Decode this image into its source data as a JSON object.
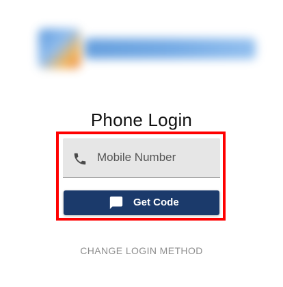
{
  "login": {
    "title": "Phone Login",
    "phone_field": {
      "placeholder": "Mobile Number",
      "icon": "phone-icon"
    },
    "submit_button": {
      "label": "Get Code",
      "icon": "message-icon",
      "color": "#1b3a6b"
    },
    "change_method_link": "CHANGE LOGIN METHOD"
  },
  "colors": {
    "highlight_border": "#ff0000",
    "field_background": "#e6e6e6",
    "link_text": "#8c8c8c"
  }
}
